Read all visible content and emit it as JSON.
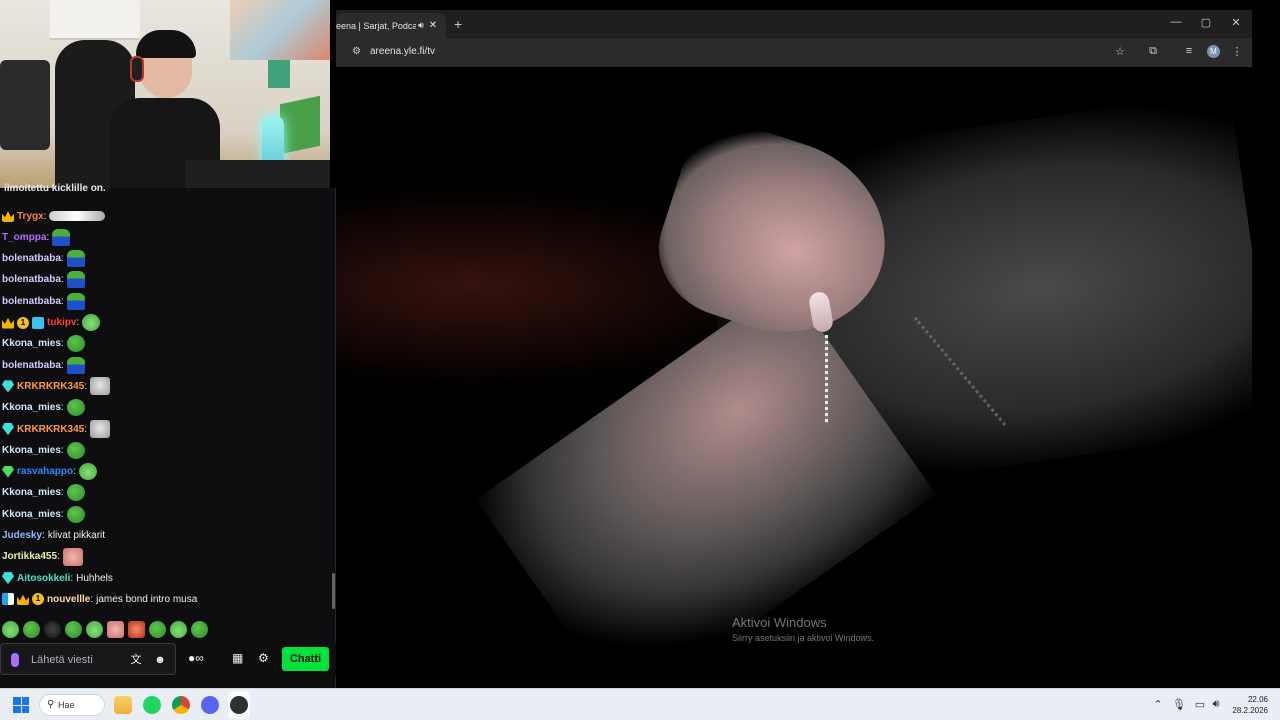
{
  "chat": {
    "clipped_text": "ilmoitettu kicklille on.",
    "messages": [
      {
        "badges": [
          "crown"
        ],
        "user": "Trygx",
        "user_color": "#ff7f50",
        "sep": ":",
        "text": "",
        "emotes": [
          "sword"
        ]
      },
      {
        "badges": [],
        "user": "T_omppa",
        "user_color": "#b26bff",
        "sep": ":",
        "text": "",
        "emotes": [
          "pepeblue"
        ]
      },
      {
        "badges": [],
        "user": "bolenatbaba",
        "user_color": "#d8c7ff",
        "sep": ":",
        "text": "",
        "emotes": [
          "pepeblue"
        ]
      },
      {
        "badges": [],
        "user": "bolenatbaba",
        "user_color": "#d8c7ff",
        "sep": ":",
        "text": "",
        "emotes": [
          "pepeblue"
        ]
      },
      {
        "badges": [],
        "user": "bolenatbaba",
        "user_color": "#d8c7ff",
        "sep": ":",
        "text": "",
        "emotes": [
          "pepeblue"
        ]
      },
      {
        "badges": [
          "crown",
          "sub",
          "tag"
        ],
        "user": "tukipv",
        "user_color": "#ff3b3b",
        "sep": ":",
        "text": "",
        "emotes": [
          "laugh"
        ]
      },
      {
        "badges": [],
        "user": "Kkona_mies",
        "user_color": "#cfe8ff",
        "sep": ":",
        "text": "",
        "emotes": [
          "pepe"
        ]
      },
      {
        "badges": [],
        "user": "bolenatbaba",
        "user_color": "#d8c7ff",
        "sep": ":",
        "text": "",
        "emotes": [
          "pepeblue"
        ]
      },
      {
        "badges": [
          "gem"
        ],
        "user": "KRKRKRK345",
        "user_color": "#ff9a3d",
        "sep": ":",
        "text": "",
        "emotes": [
          "cat"
        ]
      },
      {
        "badges": [],
        "user": "Kkona_mies",
        "user_color": "#cfe8ff",
        "sep": ":",
        "text": "",
        "emotes": [
          "pepe"
        ]
      },
      {
        "badges": [
          "gem"
        ],
        "user": "KRKRKRK345",
        "user_color": "#ff9a3d",
        "sep": ":",
        "text": "",
        "emotes": [
          "cat"
        ]
      },
      {
        "badges": [],
        "user": "Kkona_mies",
        "user_color": "#cfe8ff",
        "sep": ":",
        "text": "",
        "emotes": [
          "pepe"
        ]
      },
      {
        "badges": [
          "gem-green"
        ],
        "user": "rasvahappo",
        "user_color": "#2e8bff",
        "sep": ":",
        "text": "",
        "emotes": [
          "laugh"
        ]
      },
      {
        "badges": [],
        "user": "Kkona_mies",
        "user_color": "#cfe8ff",
        "sep": ":",
        "text": "",
        "emotes": [
          "pepe"
        ]
      },
      {
        "badges": [],
        "user": "Kkona_mies",
        "user_color": "#cfe8ff",
        "sep": ":",
        "text": "",
        "emotes": [
          "pepe"
        ]
      },
      {
        "badges": [],
        "user": "Judesky",
        "user_color": "#8fb8ff",
        "sep": ":",
        "text": "klivat pikkarit",
        "emotes": []
      },
      {
        "badges": [],
        "user": "Jortikka455",
        "user_color": "#e8f0a0",
        "sep": ":",
        "text": "",
        "emotes": [
          "face"
        ]
      },
      {
        "badges": [
          "gem"
        ],
        "user": "Aitosokkeli",
        "user_color": "#4de0c0",
        "sep": ":",
        "text": "Huhhels",
        "emotes": []
      },
      {
        "badges": [
          "stripe",
          "crown",
          "sub"
        ],
        "user": "nouvellle",
        "user_color": "#ffd9a8",
        "sep": ":",
        "text": "james bond intro musa",
        "emotes": []
      }
    ],
    "emote_bar": [
      "laugh",
      "pepe",
      "dark",
      "pepe",
      "laugh",
      "face",
      "red",
      "pepe",
      "laugh",
      "pepe"
    ],
    "input_placeholder": "Lähetä viesti",
    "send_label": "Chatti",
    "sub_badge_text": "1"
  },
  "browser": {
    "tab_title": "eena | Sarjat, Podcast",
    "url": "areena.yle.fi/tv",
    "profile_initial": "M"
  },
  "watermark": {
    "title": "Aktivoi Windows",
    "subtitle": "Siirry asetuksiin ja aktivoi Windows."
  },
  "taskbar": {
    "search_label": "Hae",
    "time": "22.06",
    "date": "28.2.2026"
  },
  "colors": {
    "accent_green": "#00e13c",
    "chat_bg": "#0e0e10",
    "taskbar_bg": "#e9eef4"
  }
}
